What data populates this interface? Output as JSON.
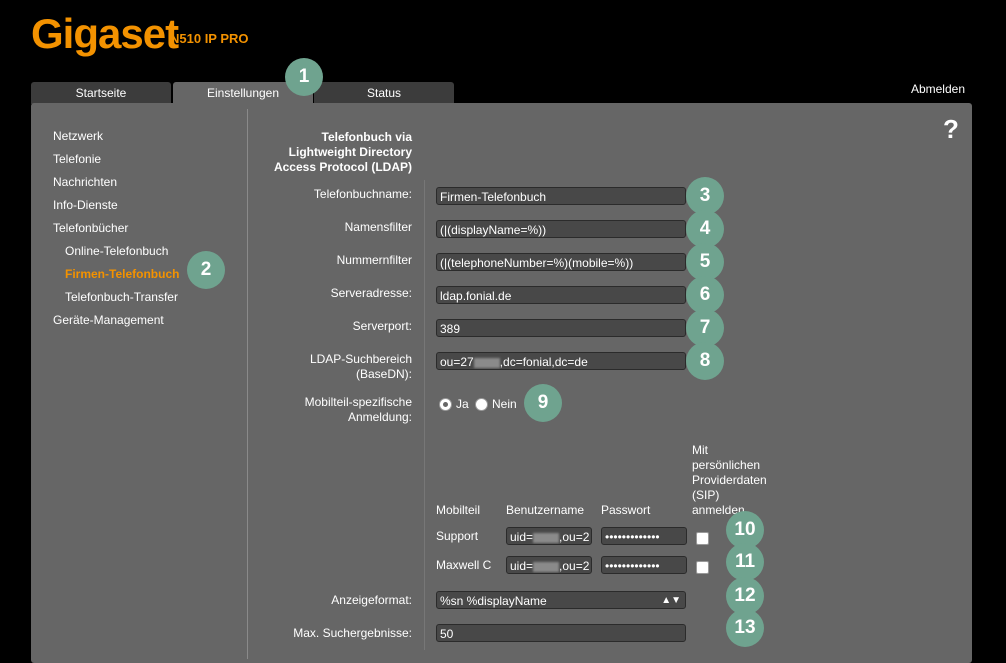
{
  "brand": {
    "logo": "Gigaset",
    "model": "N510 IP PRO"
  },
  "tabs": [
    {
      "label": "Startseite"
    },
    {
      "label": "Einstellungen"
    },
    {
      "label": "Status"
    }
  ],
  "logout_label": "Abmelden",
  "help_label": "?",
  "sidebar": {
    "items": [
      {
        "label": "Netzwerk"
      },
      {
        "label": "Telefonie"
      },
      {
        "label": "Nachrichten"
      },
      {
        "label": "Info-Dienste"
      },
      {
        "label": "Telefonbücher"
      },
      {
        "label": "Online-Telefonbuch"
      },
      {
        "label": "Firmen-Telefonbuch"
      },
      {
        "label": "Telefonbuch-Transfer"
      },
      {
        "label": "Geräte-Management"
      }
    ]
  },
  "section_title": [
    "Telefonbuch via",
    "Lightweight Directory",
    "Access Protocol (LDAP)"
  ],
  "form": {
    "phonebook_name": {
      "label": "Telefonbuchname:",
      "value": "Firmen-Telefonbuch"
    },
    "name_filter": {
      "label": "Namensfilter",
      "value": "(|(displayName=%))"
    },
    "number_filter": {
      "label": "Nummernfilter",
      "value": "(|(telephoneNumber=%)(mobile=%))"
    },
    "server_address": {
      "label": "Serveradresse:",
      "value": "ldap.fonial.de"
    },
    "server_port": {
      "label": "Serverport:",
      "value": "389"
    },
    "base_dn": {
      "label_line1": "LDAP-Suchbereich",
      "label_line2": "(BaseDN):",
      "value_prefix": "ou=27",
      "value_suffix": ",dc=fonial,dc=de"
    },
    "handset_login": {
      "label_line1": "Mobilteil-spezifische",
      "label_line2": "Anmeldung:",
      "yes": "Ja",
      "no": "Nein"
    },
    "table_headers": {
      "handset": "Mobilteil",
      "username": "Benutzername",
      "password": "Passwort",
      "sip": [
        "Mit",
        "persönlichen",
        "Providerdaten",
        "(SIP)",
        "anmelden"
      ]
    },
    "rows": [
      {
        "handset": "Support",
        "user_prefix": "uid=",
        "user_suffix": ",ou=2",
        "password": "•••••••••••••"
      },
      {
        "handset": "Maxwell C",
        "user_prefix": "uid=",
        "user_suffix": ",ou=2",
        "password": "•••••••••••••"
      }
    ],
    "display_format": {
      "label": "Anzeigeformat:",
      "value": "%sn %displayName"
    },
    "max_results": {
      "label": "Max. Suchergebnisse:",
      "value": "50"
    }
  },
  "badges": [
    "1",
    "2",
    "3",
    "4",
    "5",
    "6",
    "7",
    "8",
    "9",
    "10",
    "11",
    "12",
    "13"
  ],
  "colors": {
    "accent": "#f39200",
    "badge": "#6fa38f",
    "panel": "#666666"
  }
}
